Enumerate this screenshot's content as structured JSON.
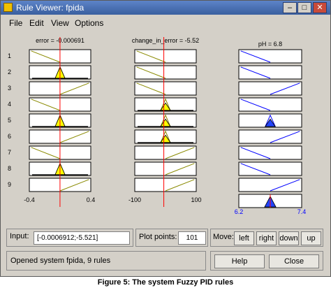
{
  "window": {
    "title": "Rule Viewer: fpida"
  },
  "menu": [
    "File",
    "Edit",
    "View",
    "Options"
  ],
  "inputs": [
    {
      "label": "error = -0.000691",
      "min": "-0.4",
      "max": "0.4",
      "range": [
        -0.4,
        0.4
      ],
      "value": -0.000691
    },
    {
      "label": "change_in_error = -5.52",
      "min": "-100",
      "max": "100",
      "range": [
        -100,
        100
      ],
      "value": -5.52
    }
  ],
  "output": {
    "label": "pH = 6.8",
    "min": "6.2",
    "max": "7.4",
    "range": [
      6.2,
      7.4
    ],
    "value": 6.8
  },
  "rules": [
    {
      "n": "1",
      "error": "NB",
      "change": "NB",
      "out": "NB"
    },
    {
      "n": "2",
      "error": "Z",
      "change": "NB",
      "out": "NB"
    },
    {
      "n": "3",
      "error": "PB",
      "change": "NB",
      "out": "PB"
    },
    {
      "n": "4",
      "error": "NB",
      "change": "Z",
      "out": "NB"
    },
    {
      "n": "5",
      "error": "Z",
      "change": "Z",
      "out": "Z"
    },
    {
      "n": "6",
      "error": "PB",
      "change": "Z",
      "out": "PB"
    },
    {
      "n": "7",
      "error": "NB",
      "change": "PB",
      "out": "NB"
    },
    {
      "n": "8",
      "error": "Z",
      "change": "PB",
      "out": "NB"
    },
    {
      "n": "9",
      "error": "PB",
      "change": "PB",
      "out": "PB"
    }
  ],
  "controls": {
    "input_label": "Input:",
    "input_value": "[-0.0006912;-5.521]",
    "plot_points_label": "Plot points:",
    "plot_points_value": "101",
    "move_label": "Move:",
    "left": "left",
    "right": "right",
    "down": "down",
    "up": "up",
    "status": "Opened system fpida, 9 rules",
    "help": "Help",
    "close": "Close"
  },
  "caption": "Figure 5: The system Fuzzy PID rules",
  "colors": {
    "fill": "#ffff00",
    "line": "#8a8a00",
    "out_line": "#0000ff",
    "out_fill": "#2244ff",
    "indicator": "#ff0000"
  }
}
